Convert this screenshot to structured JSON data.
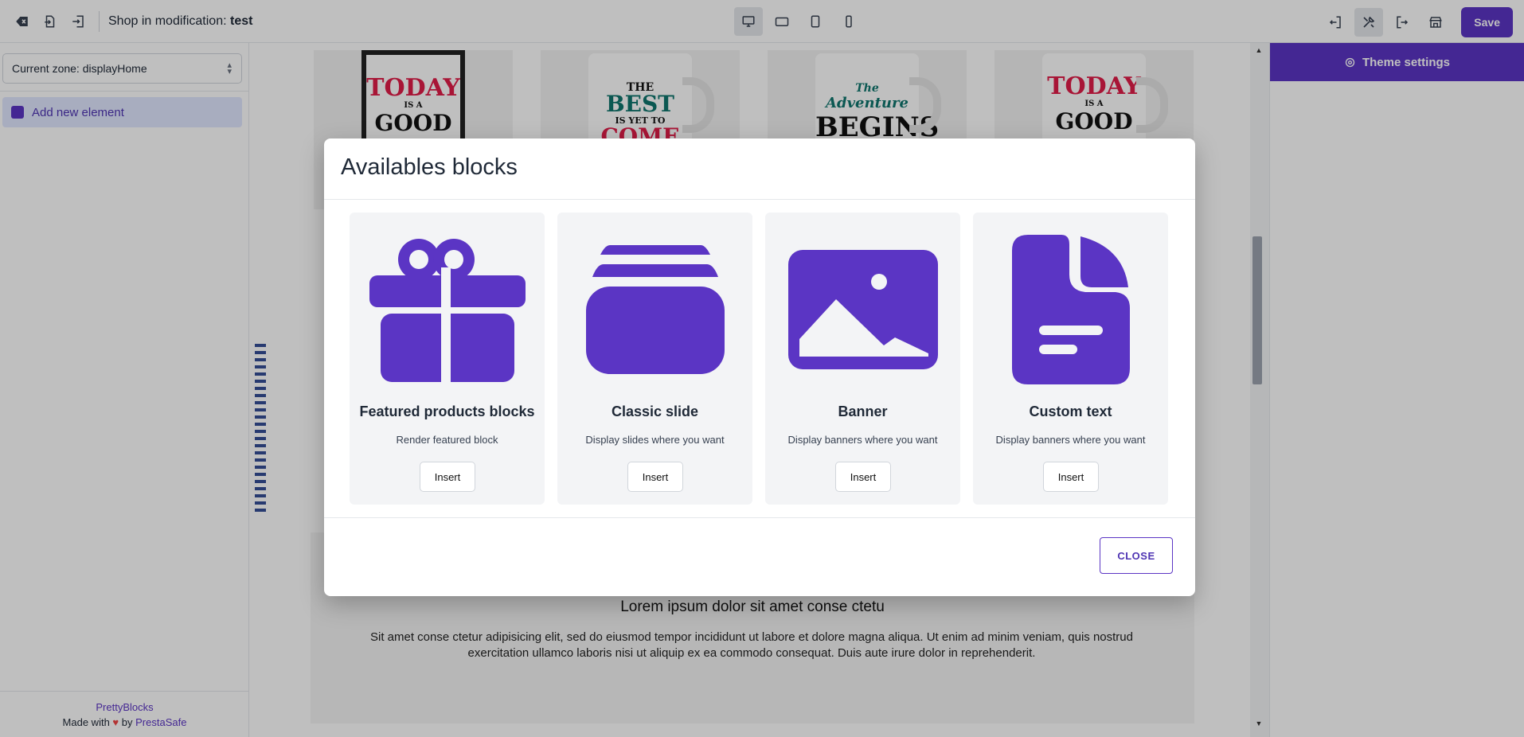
{
  "topbar": {
    "shop_label": "Shop in modification: ",
    "shop_name": "test",
    "save_label": "Save"
  },
  "sidebar": {
    "zone_select_value": "Current zone: displayHome",
    "add_element_label": "Add new element",
    "footer_brand": "PrettyBlocks",
    "footer_made_with": "Made with",
    "footer_by": "by",
    "footer_company": "PrestaSafe"
  },
  "preview": {
    "products": [
      {
        "line1": "TODAY",
        "line2": "IS A",
        "line3": "GOOD"
      },
      {
        "line1": "THE",
        "line2": "BEST",
        "line3": "IS YET TO",
        "line4": "COME"
      },
      {
        "line1": "The",
        "line2": "Adventure",
        "line3": "BEGINS"
      },
      {
        "line1": "TODAY",
        "line2": "IS A",
        "line3": "GOOD"
      }
    ],
    "lorem_title": "Lorem ipsum dolor sit amet conse ctetu",
    "lorem_text": "Sit amet conse ctetur adipisicing elit, sed do eiusmod tempor incididunt ut labore et dolore magna aliqua. Ut enim ad minim veniam, quis nostrud exercitation ullamco laboris nisi ut aliquip ex ea commodo consequat. Duis aute irure dolor in reprehenderit."
  },
  "right_panel": {
    "tab_label": "Theme settings"
  },
  "modal": {
    "title": "Availables blocks",
    "close_label": "CLOSE",
    "blocks": [
      {
        "icon": "gift-icon",
        "title": "Featured products blocks",
        "description": "Render featured block",
        "button": "Insert"
      },
      {
        "icon": "slides-stack-icon",
        "title": "Classic slide",
        "description": "Display slides where you want",
        "button": "Insert"
      },
      {
        "icon": "image-icon",
        "title": "Banner",
        "description": "Display banners where you want",
        "button": "Insert"
      },
      {
        "icon": "document-icon",
        "title": "Custom text",
        "description": "Display banners where you want",
        "button": "Insert"
      }
    ]
  },
  "colors": {
    "accent": "#5b35c4",
    "overlay": "rgba(0,0,0,0.25)"
  }
}
